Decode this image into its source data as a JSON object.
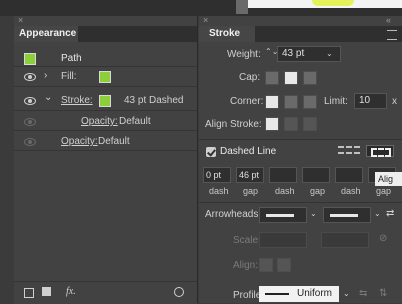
{
  "appearance": {
    "close_glyph": "×",
    "tab_label": "Appearance",
    "rows": {
      "path_label": "Path",
      "fill_label": "Fill:",
      "stroke_label": "Stroke:",
      "stroke_value": "43 pt Dashed",
      "opacity_label": "Opacity:",
      "opacity_value": "Default",
      "opacity2_label": "Opacity:",
      "opacity2_value": "Default"
    },
    "footer": {
      "fx_label": "fx."
    },
    "swatch_color": "#8ccf3a"
  },
  "stroke": {
    "close_glyph": "×",
    "collapse_glyph": "«",
    "tab_label": "Stroke",
    "weight_label": "Weight:",
    "weight_value": "43 pt",
    "cap_label": "Cap:",
    "corner_label": "Corner:",
    "limit_label": "Limit:",
    "limit_value": "10",
    "limit_unit": "x",
    "align_label": "Align Stroke:",
    "dashed_line_label": "Dashed Line",
    "dashed_checked": true,
    "dash_values": [
      "0 pt",
      "46 pt",
      "",
      "",
      "",
      ""
    ],
    "dash_labels": [
      "dash",
      "gap",
      "dash",
      "gap",
      "dash",
      "gap"
    ],
    "arrowheads_label": "Arrowheads:",
    "scale_label": "Scale:",
    "align_arrow_label": "Align:",
    "profile_label": "Profile:",
    "profile_value": "Uniform",
    "tooltip": "Alig"
  }
}
